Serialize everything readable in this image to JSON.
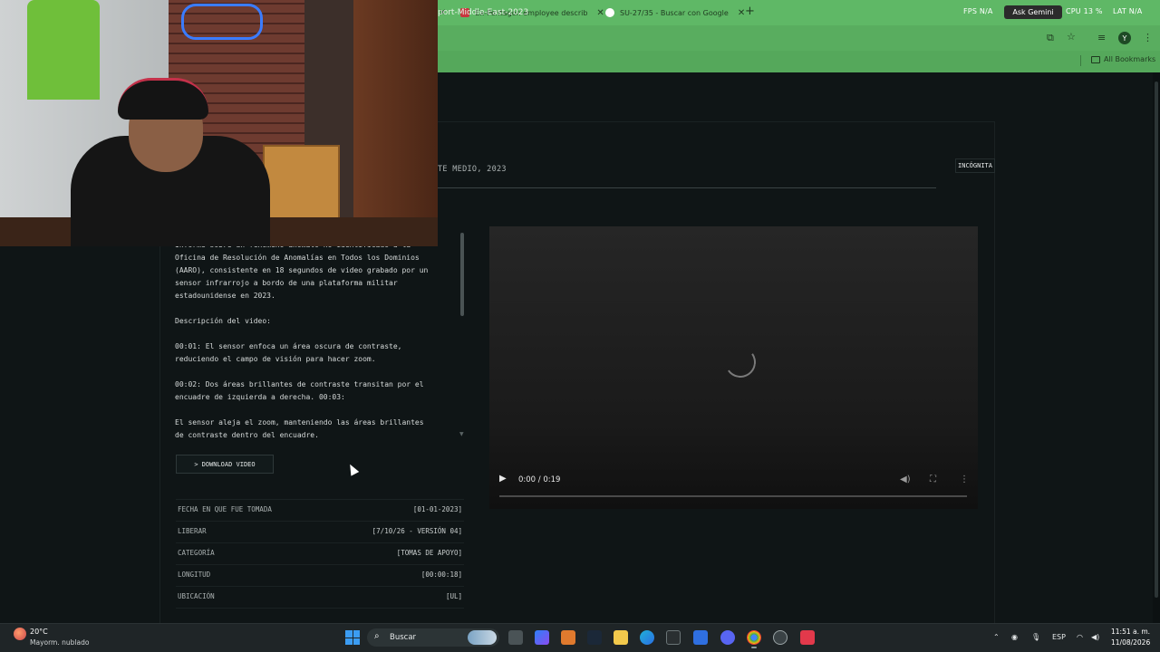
{
  "browser": {
    "tabs": [
      {
        "label": "Ex-Pentagon employee describ",
        "favicon_color": "#c8363e"
      },
      {
        "label": "SU-27/35 - Buscar con Google",
        "favicon_color": "#ffffff"
      }
    ],
    "perf_left": "FPS N/A",
    "perf_mid": "CPU 13 %",
    "perf_right": "LAT N/A",
    "gemini_label": "Ask Gemini",
    "url": "port-Middle-East-2023",
    "avatar_letter": "Y",
    "all_bookmarks": "All Bookmarks"
  },
  "page": {
    "breadcrumb": "TE MEDIO, 2023",
    "incognito_badge": "INCÓGNITA",
    "description": "Informe sobre un fenómeno anómalo no identificado a la\nOficina de Resolución de Anomalías en Todos los Dominios\n(AARO), consistente en 18 segundos de video grabado por un\nsensor infrarrojo a bordo de una plataforma militar\nestadounidense en 2023.\n\nDescripción del video:\n\n00:01: El sensor enfoca un área oscura de contraste,\nreduciendo el campo de visión para hacer zoom.\n\n00:02: Dos áreas brillantes de contraste transitan por el\nencuadre de izquierda a derecha. 00:03:\n\nEl sensor aleja el zoom, manteniendo las áreas brillantes\nde contraste dentro del encuadre.",
    "download_button": "DOWNLOAD VIDEO",
    "download_prefix": ">",
    "metadata": [
      {
        "key": "FECHA EN QUE FUE TOMADA",
        "value": "[01-01-2023]"
      },
      {
        "key": "LIBERAR",
        "value": "[7/10/26 - VERSIÓN 04]"
      },
      {
        "key": "CATEGORÍA",
        "value": "[TOMAS DE APOYO]"
      },
      {
        "key": "LONGITUD",
        "value": "[00:00:18]"
      },
      {
        "key": "UBICACIÓN",
        "value": "[UL]"
      }
    ],
    "video": {
      "time": "0:00 / 0:19",
      "progress_fraction": 0
    }
  },
  "taskbar": {
    "temperature": "20°C",
    "weather": "Mayorm. nublado",
    "search_label": "Buscar",
    "language": "ESP",
    "clock_time": "11:51 a. m.",
    "clock_date": "11/08/2026"
  }
}
